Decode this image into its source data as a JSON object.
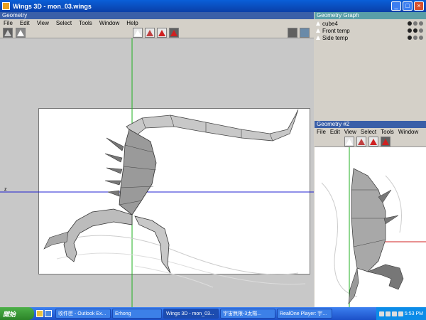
{
  "window": {
    "title": "Wings 3D - mon_03.wings"
  },
  "geometry": {
    "header": "Geometry",
    "menu": [
      "File",
      "Edit",
      "View",
      "Select",
      "Tools",
      "Window",
      "Help"
    ],
    "axis_label": "z"
  },
  "graph": {
    "header": "Geometry Graph",
    "items": [
      "cube4",
      "Front temp",
      "Side temp"
    ]
  },
  "geometry2": {
    "header": "Geometry #2",
    "menu": [
      "File",
      "Edit",
      "View",
      "Select",
      "Tools",
      "Window"
    ]
  },
  "taskbar": {
    "start": "開始",
    "tasks": [
      "收件匣 - Outlook Ex...",
      "Erhong",
      "Wings 3D - mon_03...",
      "宇宙無限-3太陽...",
      "RealOne Player: 宇..."
    ],
    "clock": "5:53 PM"
  },
  "colors": {
    "titlebar": "#0a4fc8",
    "panel": "#3a5fa8",
    "axis_x": "#2020d0",
    "axis_y": "#20b020",
    "axis_z": "#d02020"
  }
}
